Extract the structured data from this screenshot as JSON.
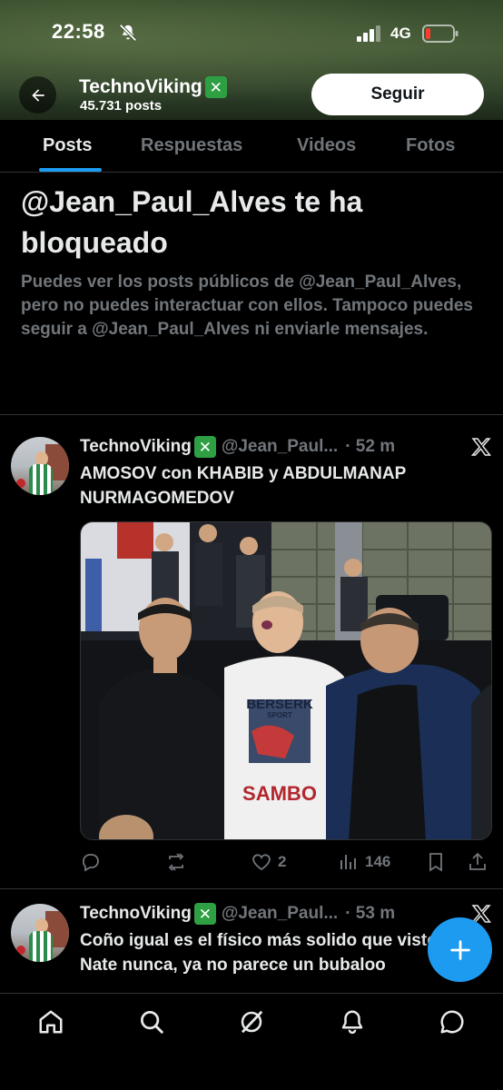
{
  "status_bar": {
    "time": "22:58",
    "network": "4G",
    "icons": [
      "bell-off-icon",
      "signal-icon",
      "battery-low-icon"
    ],
    "battery_color": "#ff3b30"
  },
  "profile": {
    "name": "TechnoViking",
    "badge_glyph": "✕",
    "badge_color": "#2ea043",
    "posts_count": "45.731 posts",
    "follow_label": "Seguir"
  },
  "tabs": [
    {
      "label": "Posts",
      "active": true
    },
    {
      "label": "Respuestas",
      "active": false
    },
    {
      "label": "Videos",
      "active": false
    },
    {
      "label": "Fotos",
      "active": false
    }
  ],
  "blocked_notice": {
    "title": "@Jean_Paul_Alves te ha bloqueado",
    "description": "Puedes ver los posts públicos de @Jean_Paul_Alves, pero no puedes interactuar con ellos. Tampoco puedes seguir a @Jean_Paul_Alves ni enviarle mensajes."
  },
  "tweets": [
    {
      "name": "TechnoViking",
      "handle": "@Jean_Paul...",
      "time": "· 52 m",
      "text": "AMOSOV con KHABIB y ABDULMANAP NURMAGOMEDOV",
      "media_text": {
        "shirt_brand": "BERSERK",
        "shirt_sub": "SPORT",
        "shirt_main": "SAMBO"
      },
      "replies": "",
      "reposts": "",
      "likes": "2",
      "views": "146"
    },
    {
      "name": "TechnoViking",
      "handle": "@Jean_Paul...",
      "time": "· 53 m",
      "text": "Coño igual es el físico más solido que visto a Nate nunca, ya no parece un bubaloo"
    }
  ],
  "accent_color": "#1d9bf0",
  "bottom_nav": [
    "home-icon",
    "search-icon",
    "grok-icon",
    "notifications-icon",
    "messages-icon"
  ]
}
